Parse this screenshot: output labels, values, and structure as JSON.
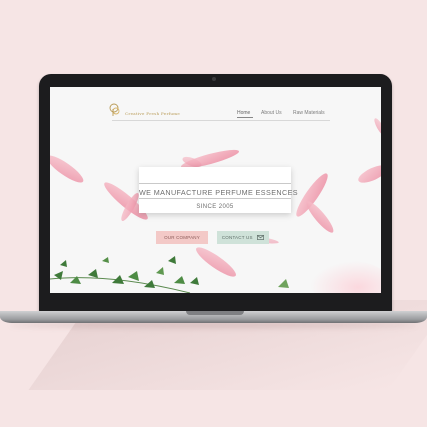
{
  "site": {
    "logo_text": "Creative Fresh Perfume",
    "nav": [
      "Home",
      "About Us",
      "Raw Materials"
    ],
    "hero": {
      "title": "WE MANUFACTURE PERFUME ESSENCES",
      "subtitle": "SINCE 2005"
    },
    "buttons": {
      "company": "OUR COMPANY",
      "contact": "CONTACT US"
    }
  },
  "colors": {
    "background": "#f6e5e5",
    "petal": "#f0a7b6",
    "leaf": "#3f7a3a",
    "logo_gold": "#b89a55",
    "company_button": "#f3c9c7",
    "contact_button": "#cfe2d9"
  },
  "icons": {
    "mail": "envelope-icon",
    "logo": "perfume-logo-icon"
  }
}
